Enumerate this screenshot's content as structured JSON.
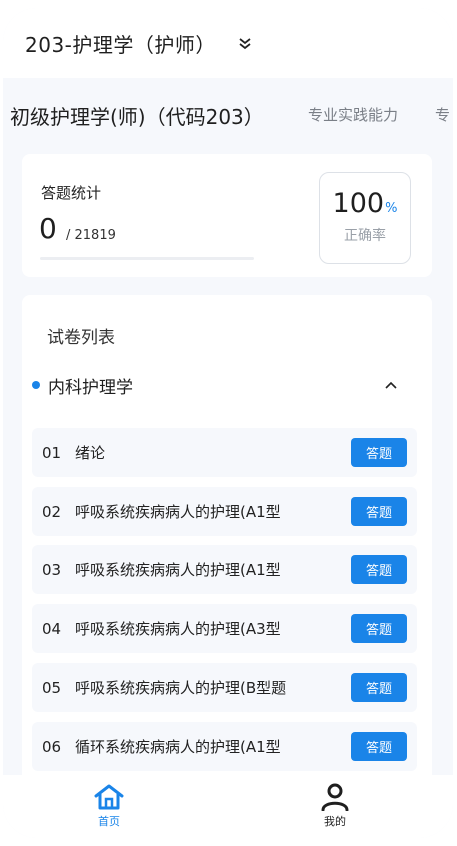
{
  "header": {
    "title": "203-护理学（护师）",
    "chevron_icon": "double-chevron-down-icon"
  },
  "subtabs": [
    {
      "label": "初级护理学(师)（代码203）",
      "active": true
    },
    {
      "label": "专业实践能力",
      "active": false
    },
    {
      "label": "专",
      "active": false
    }
  ],
  "stats": {
    "label": "答题统计",
    "answered": "0",
    "total": "/ 21819",
    "progress_fraction": 0,
    "rate_value": "100",
    "rate_unit": "%",
    "rate_label": "正确率"
  },
  "paper_list": {
    "heading": "试卷列表",
    "category": {
      "name": "内科护理学",
      "expanded": true,
      "toggle_icon": "chevron-up-icon"
    },
    "rows": [
      {
        "index": "01",
        "title": "绪论",
        "button": "答题"
      },
      {
        "index": "02",
        "title": "呼吸系统疾病病人的护理(A1型",
        "button": "答题"
      },
      {
        "index": "03",
        "title": "呼吸系统疾病病人的护理(A1型",
        "button": "答题"
      },
      {
        "index": "04",
        "title": "呼吸系统疾病病人的护理(A3型",
        "button": "答题"
      },
      {
        "index": "05",
        "title": "呼吸系统疾病病人的护理(B型题",
        "button": "答题"
      },
      {
        "index": "06",
        "title": "循环系统疾病病人的护理(A1型",
        "button": "答题"
      }
    ]
  },
  "tabbar": {
    "home": {
      "label": "首页",
      "icon": "home-icon"
    },
    "me": {
      "label": "我的",
      "icon": "user-icon"
    }
  },
  "colors": {
    "accent": "#1a84e8",
    "background": "#f6f8fc"
  }
}
